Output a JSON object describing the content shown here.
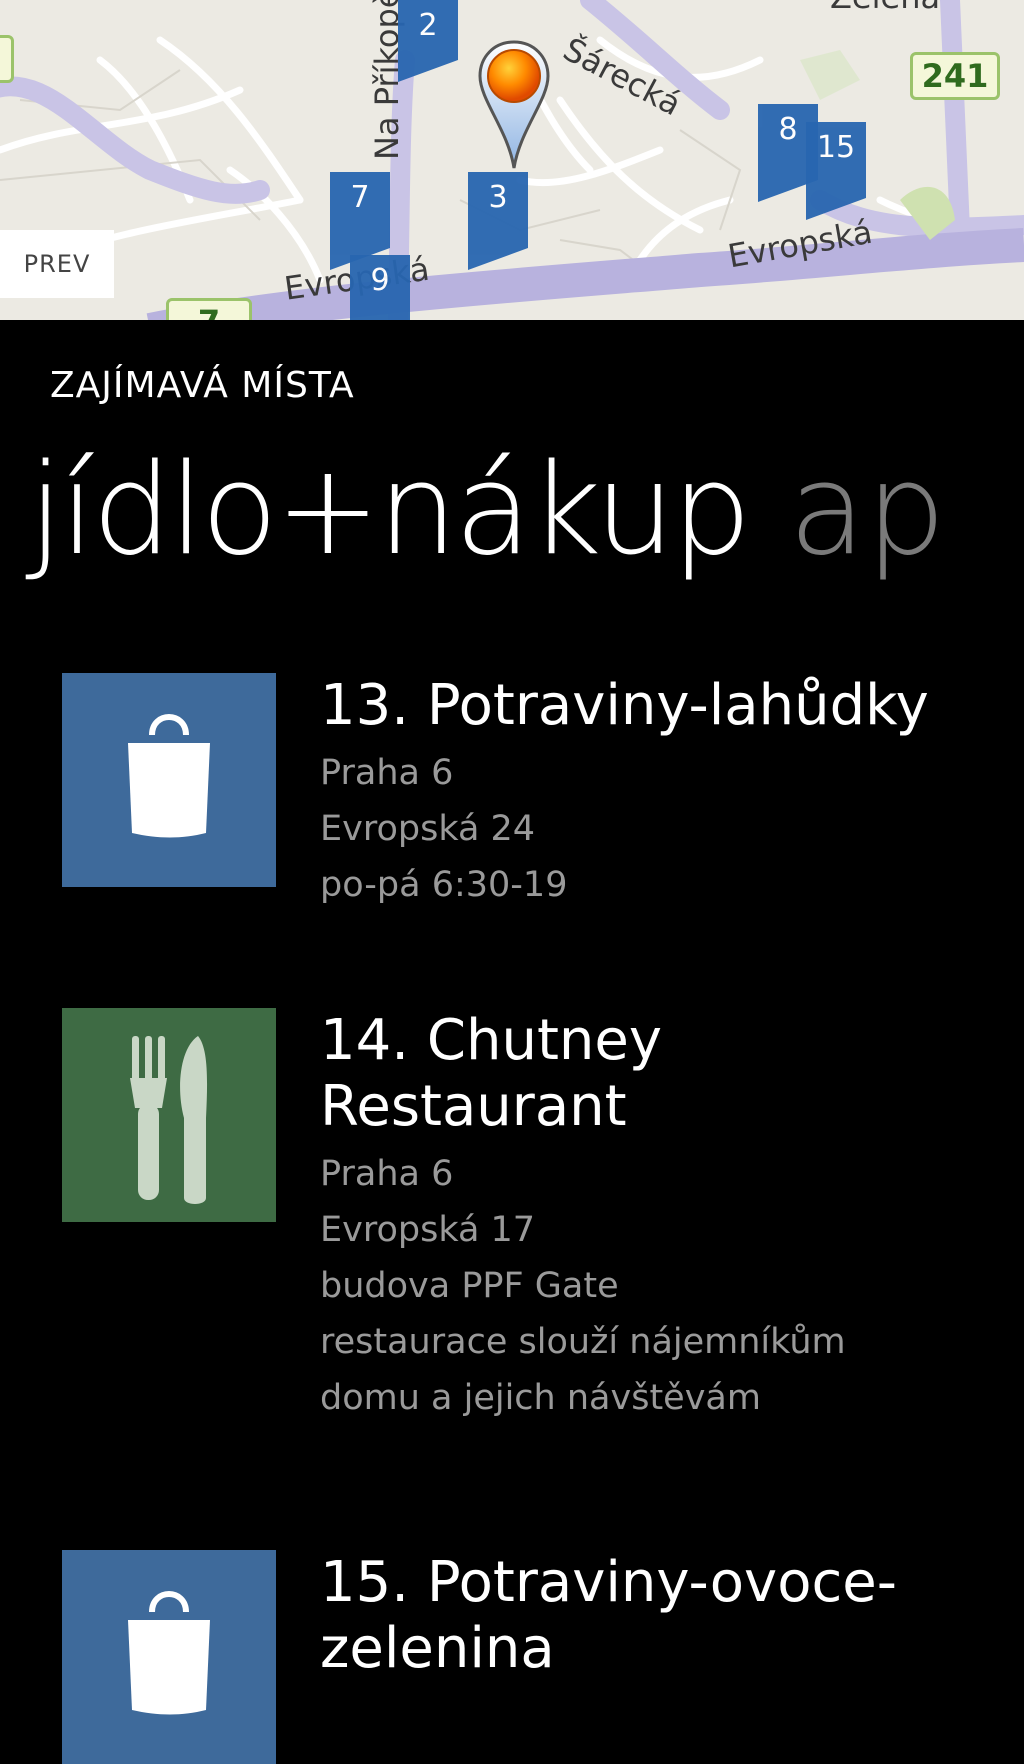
{
  "map": {
    "road_labels": {
      "sarecka": "Šárecká",
      "naprikope": "Na Příkopě",
      "evropska_left": "Evropská",
      "evropska_right": "Evropská",
      "zelena": "Zelená"
    },
    "shields": {
      "s241": "241",
      "s7": "7"
    },
    "markers": {
      "m2": "2",
      "m7": "7",
      "m3": "3",
      "m9": "9",
      "m8": "8",
      "m15": "15"
    },
    "prev_label": "PREV"
  },
  "header": {
    "section_title": "ZAJÍMAVÁ MÍSTA",
    "pivot_active": "jídlo+nákup",
    "pivot_next": "ap"
  },
  "items": [
    {
      "title": "13. Potraviny-lahůdky",
      "category_icon": "shopping-bag-icon",
      "details": [
        "Praha 6",
        "Evropská 24",
        "po-pá 6:30-19"
      ]
    },
    {
      "title_line1": "14. Chutney",
      "title_line2": "Restaurant",
      "category_icon": "fork-knife-icon",
      "details": [
        "Praha 6",
        "Evropská 17",
        "budova PPF Gate",
        "restaurace slouží nájemníkům",
        "domu a jejich návštěvám"
      ]
    },
    {
      "title_line1": "15. Potraviny-ovoce-",
      "title_line2": "zelenina",
      "category_icon": "shopping-bag-icon",
      "details": []
    }
  ],
  "colors": {
    "background": "#000000",
    "shop_tile": "#3e6a9b",
    "food_tile": "#3e6b44",
    "marker": "#2866b0",
    "secondary_text": "#9a9a9a"
  }
}
